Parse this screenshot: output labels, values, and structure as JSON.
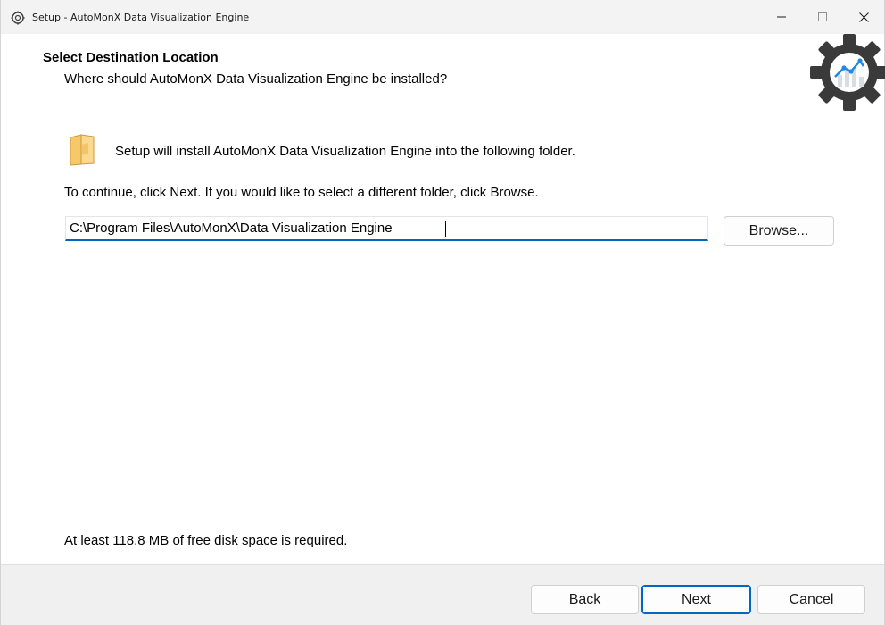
{
  "window": {
    "title": "Setup - AutoMonX Data Visualization Engine",
    "controls": {
      "minimize": "minimize-icon",
      "maximize": "maximize-icon",
      "close": "close-icon"
    }
  },
  "header": {
    "title": "Select Destination Location",
    "subtitle": "Where should AutoMonX Data Visualization Engine be installed?",
    "logo_icon": "gear-chart-icon"
  },
  "content": {
    "folder_icon": "folder-icon",
    "intro": "Setup will install AutoMonX Data Visualization Engine into the following folder.",
    "instruction": "To continue, click Next. If you would like to select a different folder, click Browse.",
    "path_value": "C:\\Program Files\\AutoMonX\\Data Visualization Engine",
    "browse_label": "Browse...",
    "disk_space": "At least 118.8 MB of free disk space is required."
  },
  "footer": {
    "back_label": "Back",
    "next_label": "Next",
    "cancel_label": "Cancel"
  },
  "colors": {
    "accent": "#0067c0",
    "gear": "#3a3a3a",
    "chart_line": "#1e88e5",
    "folder": "#f7c86a"
  }
}
